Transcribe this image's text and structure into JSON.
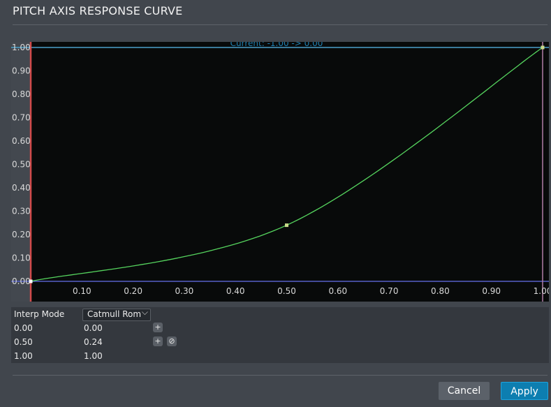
{
  "window": {
    "title": "PITCH AXIS RESPONSE CURVE"
  },
  "curve": {
    "current_label": "Current: -1.00 -> 0.00",
    "y_ticks": [
      "1.00",
      "0.90",
      "0.80",
      "0.70",
      "0.60",
      "0.50",
      "0.40",
      "0.30",
      "0.20",
      "0.10",
      "0.00"
    ],
    "x_ticks": [
      "0.10",
      "0.20",
      "0.30",
      "0.40",
      "0.50",
      "0.60",
      "0.70",
      "0.80",
      "0.90",
      "1.00"
    ],
    "points": [
      {
        "x": 0.0,
        "y": 0.0
      },
      {
        "x": 0.5,
        "y": 0.24
      },
      {
        "x": 1.0,
        "y": 1.0
      }
    ],
    "colors": {
      "plot_bg": "#080a0a",
      "curve": "#55d45e",
      "point": "#c8d98a",
      "top_line": "#4a9fc9",
      "bottom_line": "#5560c8",
      "left_line": "#d24b4b",
      "right_line": "#b07ca6",
      "label": "#1f7fb0"
    }
  },
  "table": {
    "interp_label": "Interp Mode",
    "interp_value": "Catmull Rom",
    "rows": [
      {
        "in": "0.00",
        "out": "0.00"
      },
      {
        "in": "0.50",
        "out": "0.24"
      },
      {
        "in": "1.00",
        "out": "1.00"
      }
    ],
    "icons": {
      "add": "add-icon",
      "remove": "remove-icon"
    }
  },
  "buttons": {
    "cancel": "Cancel",
    "apply": "Apply"
  }
}
